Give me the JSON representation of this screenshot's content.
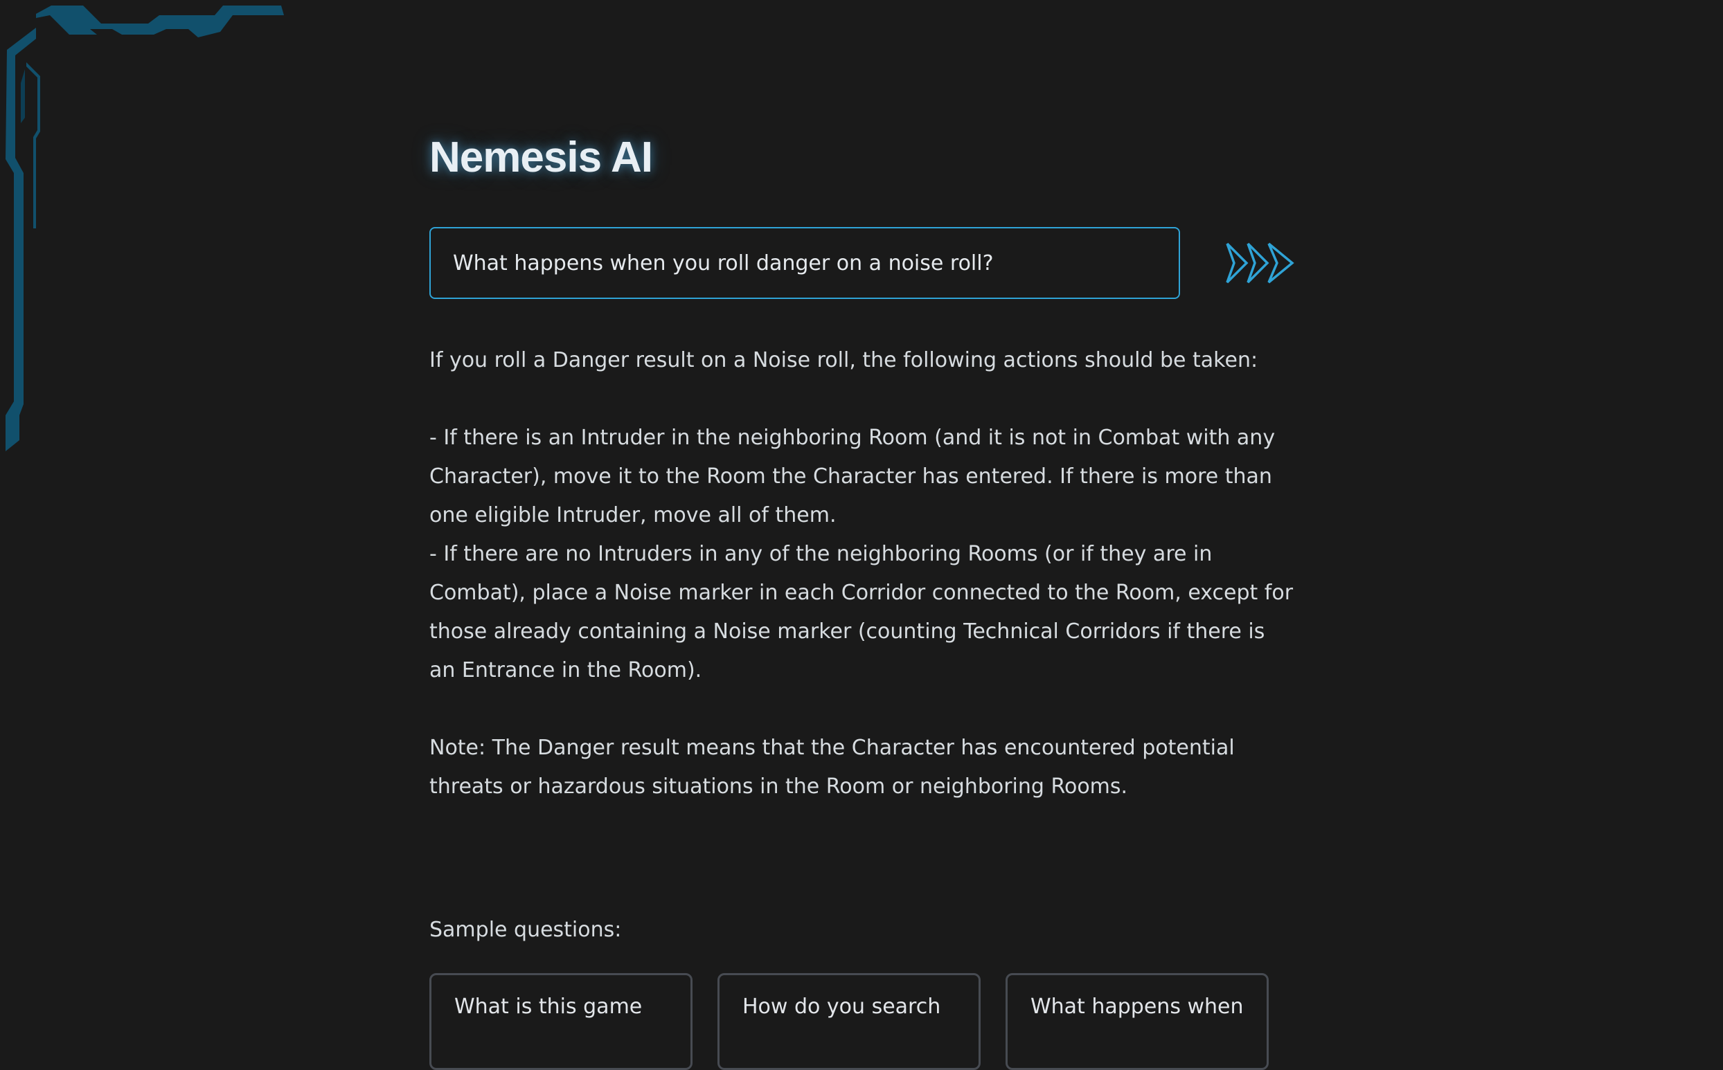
{
  "app": {
    "title": "Nemesis AI"
  },
  "search": {
    "value": "What happens when you roll danger on a noise roll?",
    "submit_icon": "triple-chevron-right-icon"
  },
  "answer": {
    "paragraphs": [
      "If you roll a Danger result on a Noise roll, the following actions should be taken:",
      "- If there is an Intruder in the neighboring Room (and it is not in Combat with any Character), move it to the Room the Character has entered. If there is more than one eligible Intruder, move all of them.",
      "- If there are no Intruders in any of the neighboring Rooms (or if they are in Combat), place a Noise marker in each Corridor connected to the Room, except for those already containing a Noise marker (counting Technical Corridors if there is an Entrance in the Room).",
      "Note: The Danger result means that the Character has encountered potential threats or hazardous situations in the Room or neighboring Rooms."
    ]
  },
  "samples": {
    "label": "Sample questions:",
    "items": [
      "What is this game",
      "How do you search",
      "What happens when"
    ]
  },
  "colors": {
    "background": "#1a1a1a",
    "accent": "#2fa3d6",
    "decoration": "#11506c",
    "card_border": "#474b52"
  }
}
